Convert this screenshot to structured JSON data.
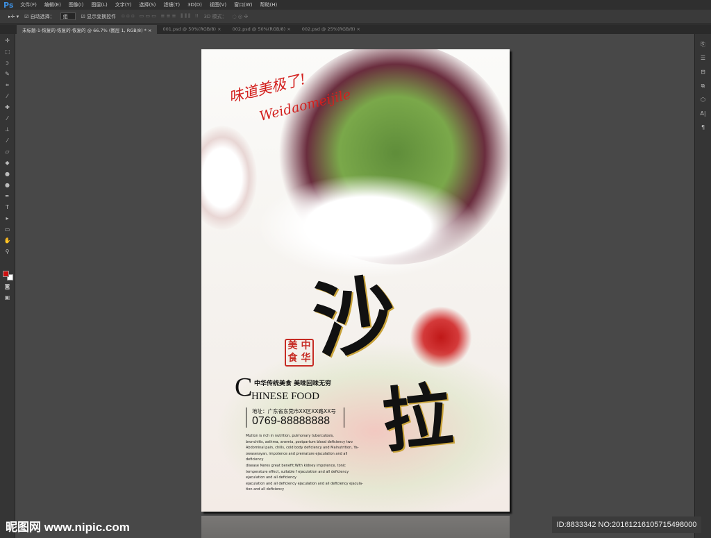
{
  "app": {
    "logo": "Ps"
  },
  "menu": [
    "文件(F)",
    "编辑(E)",
    "图像(I)",
    "图层(L)",
    "文字(Y)",
    "选择(S)",
    "滤镜(T)",
    "3D(D)",
    "视图(V)",
    "窗口(W)",
    "帮助(H)"
  ],
  "options": {
    "auto_select_label": "自动选择：",
    "auto_select_value": "组",
    "show_transform_label": "显示变换控件",
    "mode_3d_label": "3D 模式："
  },
  "tabs": [
    {
      "label": "未标题-1-恢复的-恢复的-恢复的 @ 66.7% (图层 1, RGB/8) *",
      "close": "×"
    },
    {
      "label": "001.psd @ 50%(RGB/8)",
      "close": "×"
    },
    {
      "label": "002.psd @ 50%(RGB/8)",
      "close": "×"
    },
    {
      "label": "002.psd @ 25%(RGB/8)",
      "close": "×"
    }
  ],
  "colors": {
    "foreground": "#cc1010",
    "background": "#ffffff",
    "accent": "#d3201e"
  },
  "poster": {
    "slogan_cn": "味道美极了!",
    "slogan_en": "Weidaomeijile",
    "title_chars": [
      "沙",
      "拉"
    ],
    "seal": [
      "美",
      "中",
      "食",
      "华"
    ],
    "subtitle": "中华传统美食  美味回味无穷",
    "chinese_food_c": "C",
    "chinese_food_rest": "HINESE FOOD",
    "address": "地址：广东省东莞市XX区XX路XX号",
    "phone": "0769-88888888",
    "body_lines": [
      "Mutton is rich in nutrition, pulmonary tuberculosis,",
      "bronchitis, asthma, anemia, postpartum blood deficiency two",
      "Abdominal pain, chills, cold body deficiency and Malnutrition, Ya-",
      "owaserayan, impotence and premature ejaculation and all deficiency",
      "disease Neres great benefit;With kidney impotence, tonic",
      "temperature effect, suitable f ejaculation and all deficiency",
      " ejaculation and all deficiency",
      " ejaculation and all deficiency  ejaculation and all deficiency  ejacula-",
      "tion and all deficiency"
    ]
  },
  "watermark": "昵图网 www.nipic.com",
  "image_id": "ID:8833342 NO:20161216105715498000"
}
